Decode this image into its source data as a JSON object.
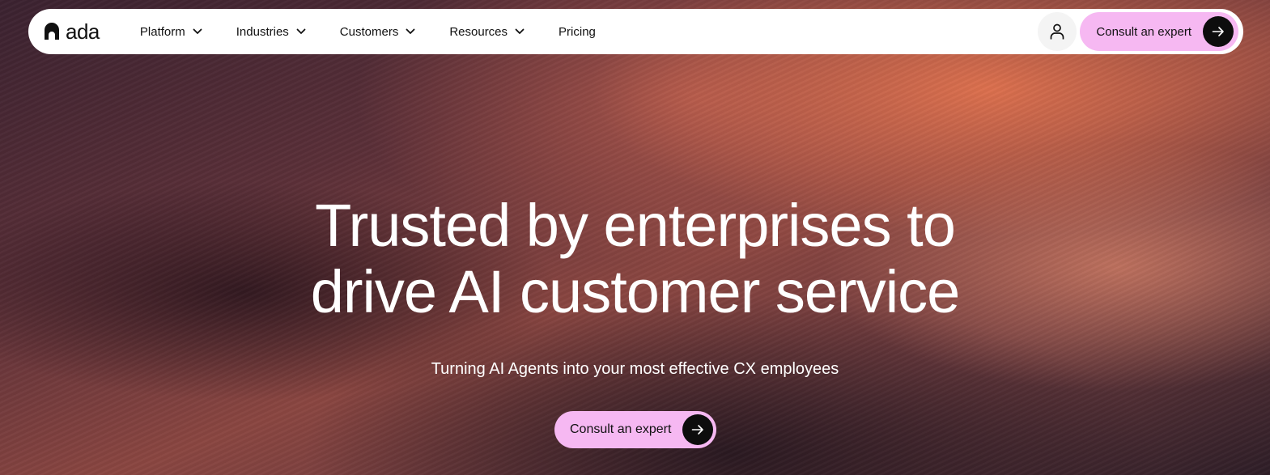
{
  "brand": {
    "name": "ada",
    "accent_color": "#f6b8f2",
    "dark_color": "#0d0d0d"
  },
  "nav": {
    "items": [
      {
        "label": "Platform",
        "has_dropdown": true
      },
      {
        "label": "Industries",
        "has_dropdown": true
      },
      {
        "label": "Customers",
        "has_dropdown": true
      },
      {
        "label": "Resources",
        "has_dropdown": true
      },
      {
        "label": "Pricing",
        "has_dropdown": false
      }
    ],
    "account_icon": "user-icon",
    "cta_label": "Consult an expert",
    "cta_icon": "arrow-right-icon"
  },
  "hero": {
    "headline_line1": "Trusted by enterprises to",
    "headline_line2": "drive AI customer service",
    "subheadline": "Turning AI Agents into your most effective CX employees",
    "cta_label": "Consult an expert",
    "cta_icon": "arrow-right-icon"
  }
}
